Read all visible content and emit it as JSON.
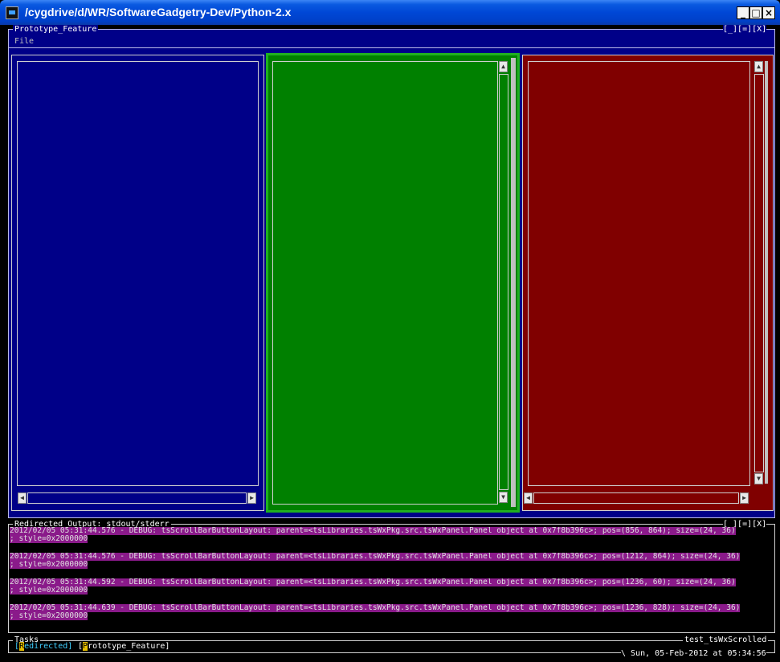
{
  "window": {
    "title": "/cygdrive/d/WR/SoftwareGadgetry-Dev/Python-2.x"
  },
  "prototype": {
    "title": "Prototype_Feature",
    "controls": "[_][=][X]",
    "menu": {
      "file": "File"
    }
  },
  "panels": {
    "blue": "#000088",
    "green": "#008000",
    "red": "#800000"
  },
  "output": {
    "title": "Redirected Output: stdout/stderr",
    "controls": "[_][=][X]",
    "lines": [
      {
        "a": "2012/02/05 05:31:44.576 - DEBUG: tsScrollBarButtonLayout: parent=<tsLibraries.tsWxPkg.src.tsWxPanel.Panel object at 0x7f8b396c>; pos=(856, 864); size=(24, 36)",
        "b": "; style=0x2000000"
      },
      {
        "a": "2012/02/05 05:31:44.576 - DEBUG: tsScrollBarButtonLayout: parent=<tsLibraries.tsWxPkg.src.tsWxPanel.Panel object at 0x7f8b396c>; pos=(1212, 864); size=(24, 36)",
        "b": "; style=0x2000000"
      },
      {
        "a": "2012/02/05 05:31:44.592 - DEBUG: tsScrollBarButtonLayout: parent=<tsLibraries.tsWxPkg.src.tsWxPanel.Panel object at 0x7f8b396c>; pos=(1236, 60); size=(24, 36)",
        "b": "; style=0x2000000"
      },
      {
        "a": "2012/02/05 05:31:44.639 - DEBUG: tsScrollBarButtonLayout: parent=<tsLibraries.tsWxPkg.src.tsWxPanel.Panel object at 0x7f8b396c>; pos=(1236, 828); size=(24, 36)",
        "b": "; style=0x2000000"
      }
    ]
  },
  "tasks": {
    "title": "Tasks",
    "app_name": "test_tsWxScrolled",
    "items": [
      {
        "first": "R",
        "rest": "edirected"
      },
      {
        "first": "P",
        "rest": "rototype_Feature"
      }
    ],
    "clock": "\\ Sun, 05-Feb-2012 at 05:34:56"
  }
}
